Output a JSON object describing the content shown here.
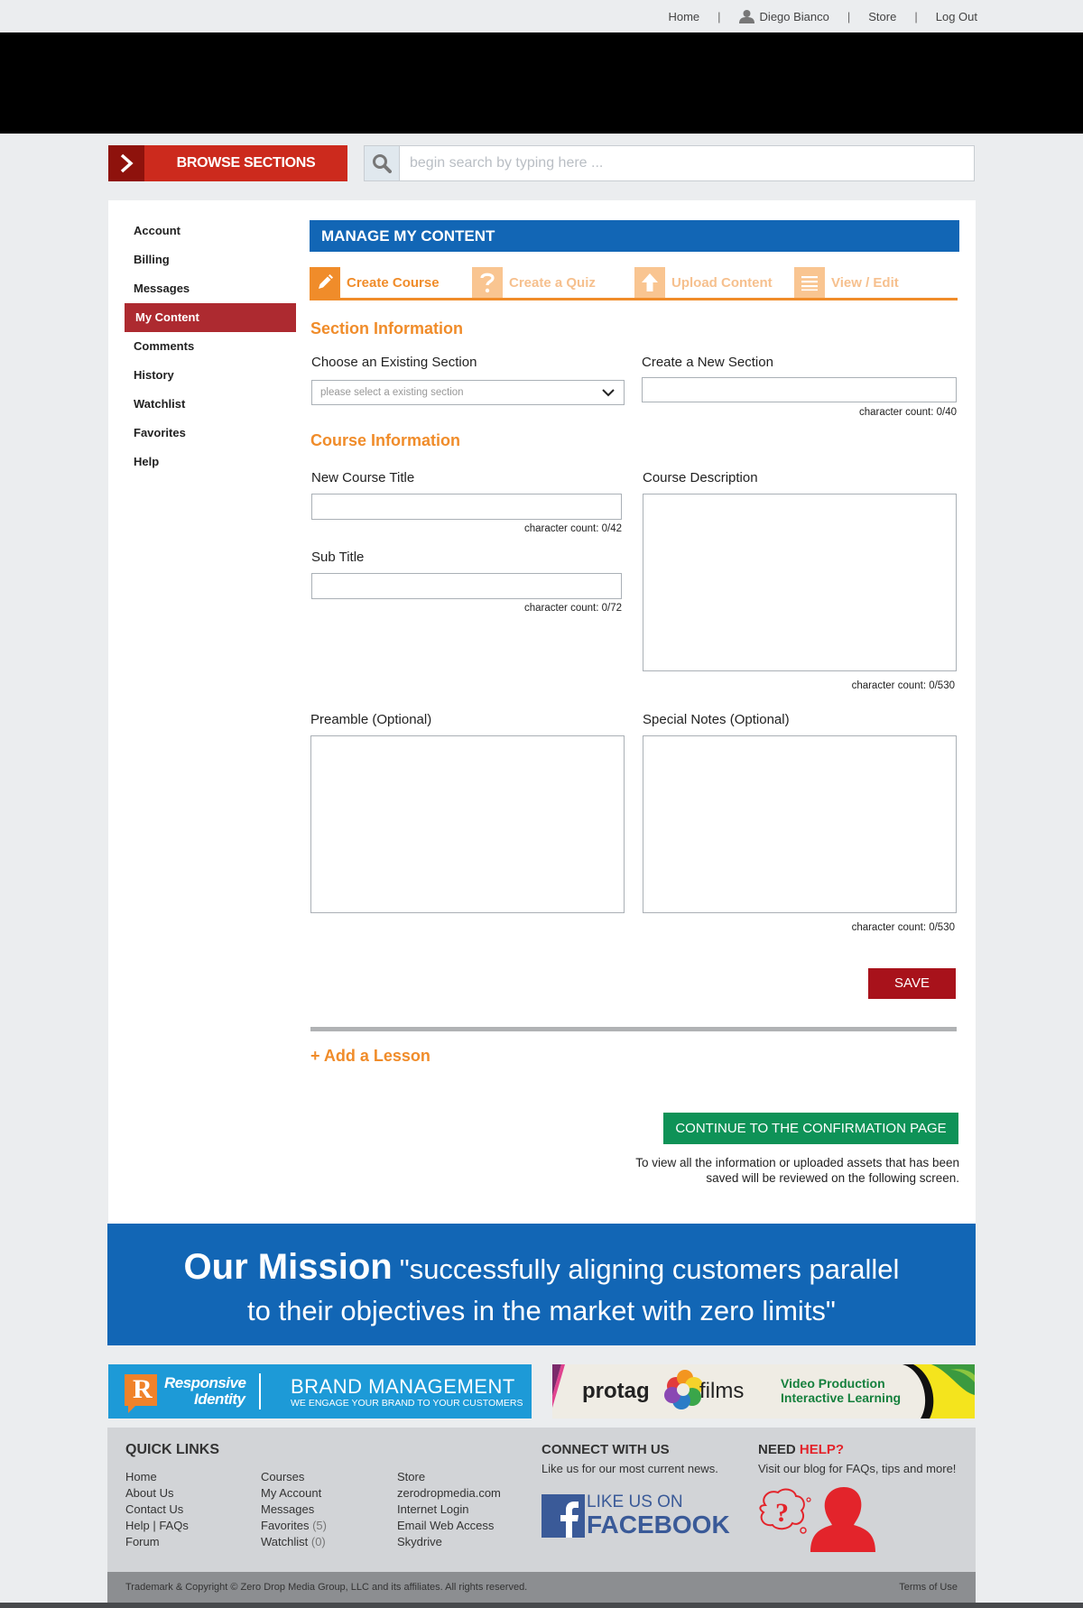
{
  "topnav": {
    "home": "Home",
    "user": "Diego Bianco",
    "store": "Store",
    "logout": "Log Out",
    "separator": "|"
  },
  "browse": {
    "label": "BROWSE SECTIONS"
  },
  "search": {
    "placeholder": "begin search by typing here ..."
  },
  "sidebar": {
    "items": [
      {
        "label": "Account",
        "active": false
      },
      {
        "label": "Billing",
        "active": false
      },
      {
        "label": "Messages",
        "active": false
      },
      {
        "label": "My Content",
        "active": true
      },
      {
        "label": "Comments",
        "active": false
      },
      {
        "label": "History",
        "active": false
      },
      {
        "label": "Watchlist",
        "active": false
      },
      {
        "label": "Favorites",
        "active": false
      },
      {
        "label": "Help",
        "active": false
      }
    ]
  },
  "main": {
    "title": "MANAGE MY CONTENT",
    "tabs": [
      {
        "label": "Create Course",
        "icon": "pencil-icon",
        "active": true
      },
      {
        "label": "Create a Quiz",
        "icon": "question-icon",
        "active": false
      },
      {
        "label": "Upload Content",
        "icon": "upload-arrow-icon",
        "active": false
      },
      {
        "label": "View / Edit",
        "icon": "list-icon",
        "active": false
      }
    ],
    "section_info": {
      "heading": "Section Information",
      "existing_label": "Choose an Existing Section",
      "existing_placeholder": "please select a existing section",
      "new_label": "Create a New Section",
      "new_count": "character count: 0/40"
    },
    "course_info": {
      "heading": "Course Information",
      "title_label": "New Course Title",
      "title_count": "character count: 0/42",
      "subtitle_label": "Sub Title",
      "subtitle_count": "character count: 0/72",
      "description_label": "Course Description",
      "description_count": "character count: 0/530",
      "preamble_label": "Preamble (Optional)",
      "notes_label": "Special Notes (Optional)",
      "notes_count": "character count: 0/530"
    },
    "save_label": "SAVE",
    "add_lesson": "+ Add a Lesson",
    "continue_label": "CONTINUE TO THE CONFIRMATION PAGE",
    "continue_note": "To view all the information or uploaded assets that has been saved will be reviewed on the following screen."
  },
  "mission": {
    "bold": "Our Mission",
    "line1": "\"successfully aligning customers parallel",
    "line2": "to their objectives in the market with zero limits\""
  },
  "ads": {
    "ad1": {
      "r_letter": "R",
      "name1": "Responsive",
      "name2": "Identity",
      "headline": "BRAND MANAGEMENT",
      "tagline": "WE ENGAGE YOUR BRAND TO YOUR CUSTOMERS"
    },
    "ad2": {
      "brand_left": "protag",
      "brand_right": "films",
      "line1": "Video Production",
      "line2": "Interactive Learning"
    }
  },
  "footer": {
    "quick_links_heading": "QUICK LINKS",
    "col1": [
      "Home",
      "About Us",
      "Contact Us",
      "Help | FAQs",
      "Forum"
    ],
    "col2": [
      {
        "label": "Courses",
        "count": ""
      },
      {
        "label": "My Account",
        "count": ""
      },
      {
        "label": "Messages",
        "count": ""
      },
      {
        "label": "Favorites",
        "count": "(5)"
      },
      {
        "label": "Watchlist",
        "count": "(0)"
      }
    ],
    "col3": [
      "Store",
      "zerodropmedia.com",
      "Internet Login",
      "Email Web Access",
      "Skydrive"
    ],
    "connect_heading": "CONNECT WITH US",
    "connect_text": "Like us for our most current news.",
    "fb_line1": "LIKE US ON",
    "fb_line2": "FACEBOOK",
    "help_heading_a": "NEED",
    "help_heading_b": "HELP?",
    "help_text": "Visit our blog for FAQs, tips and more!",
    "copyright": "Trademark & Copyright © Zero Drop Media Group, LLC and its affiliates. All rights reserved.",
    "terms": "Terms of Use"
  },
  "colors": {
    "brand_red": "#cc2a1d",
    "brand_blue": "#1266b5",
    "accent_orange": "#f08c2a",
    "save_red": "#a8121b",
    "continue_green": "#0e9257"
  }
}
